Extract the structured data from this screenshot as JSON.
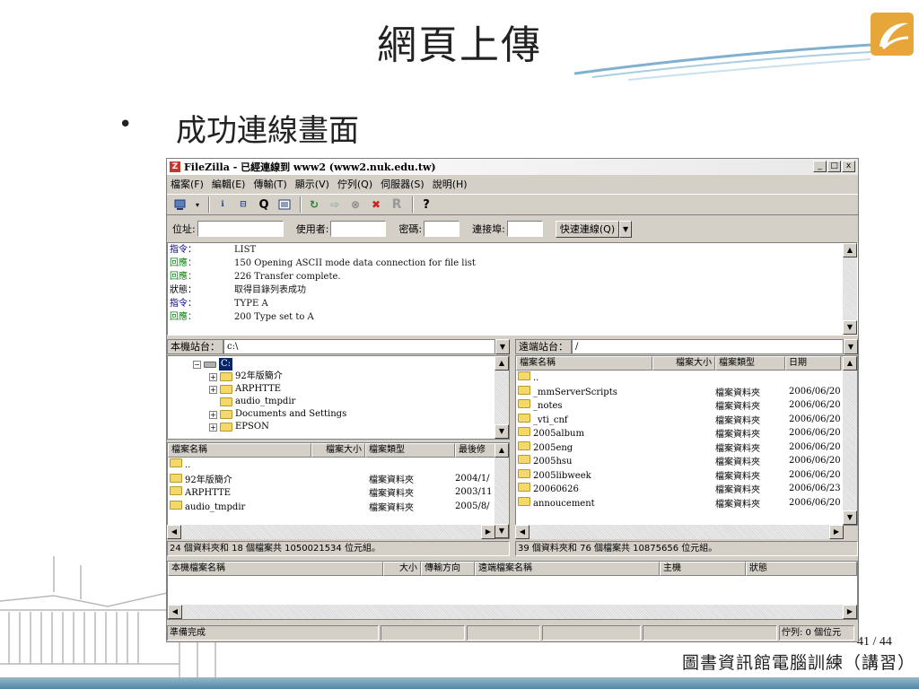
{
  "slide": {
    "title": "網頁上傳",
    "bullet": "•",
    "bullet_text": "成功連線畫面",
    "page_number": "41 / 44",
    "footer": "圖書資訊館電腦訓練（講習）"
  },
  "window": {
    "title": "FileZilla - 已經連線到 www2 (www2.nuk.edu.tw)",
    "app_icon": "Z",
    "controls": {
      "minimize": "_",
      "maximize": "□",
      "close": "x"
    }
  },
  "menu": [
    "檔案(F)",
    "編輯(E)",
    "傳輸(T)",
    "顯示(V)",
    "佇列(Q)",
    "伺服器(S)",
    "說明(H)"
  ],
  "quickconnect": {
    "address_label": "位址:",
    "user_label": "使用者:",
    "password_label": "密碼:",
    "port_label": "連接埠:",
    "button": "快速連線(Q)",
    "dropdown": "▼"
  },
  "log": [
    {
      "kind": "指令：",
      "type": "cmd",
      "text": "LIST"
    },
    {
      "kind": "回應：",
      "type": "resp",
      "text": "150 Opening ASCII mode data connection for file list"
    },
    {
      "kind": "回應：",
      "type": "resp",
      "text": "226 Transfer complete."
    },
    {
      "kind": "狀態：",
      "type": "status",
      "text": "取得目錄列表成功"
    },
    {
      "kind": "指令：",
      "type": "cmd",
      "text": "TYPE A"
    },
    {
      "kind": "回應：",
      "type": "resp",
      "text": "200 Type set to A"
    }
  ],
  "local": {
    "site_label": "本機站台：",
    "path": "c:\\",
    "tree": [
      {
        "label": "C:",
        "indent": 0,
        "expander": "−",
        "drive": true
      },
      {
        "label": "92年版簡介",
        "indent": 1,
        "expander": "+"
      },
      {
        "label": "ARPHTTE",
        "indent": 1,
        "expander": "+"
      },
      {
        "label": "audio_tmpdir",
        "indent": 1,
        "expander": ""
      },
      {
        "label": "Documents and Settings",
        "indent": 1,
        "expander": "+"
      },
      {
        "label": "EPSON",
        "indent": 1,
        "expander": "+"
      }
    ],
    "columns": [
      "檔案名稱",
      "檔案大小",
      "檔案類型",
      "最後修"
    ],
    "files": [
      {
        "name": "..",
        "size": "",
        "type": "",
        "date": ""
      },
      {
        "name": "92年版簡介",
        "size": "",
        "type": "檔案資料夾",
        "date": "2004/1/"
      },
      {
        "name": "ARPHTTE",
        "size": "",
        "type": "檔案資料夾",
        "date": "2003/11"
      },
      {
        "name": "audio_tmpdir",
        "size": "",
        "type": "檔案資料夾",
        "date": "2005/8/"
      }
    ],
    "summary": "24 個資料夾和 18 個檔案共 1050021534 位元組。"
  },
  "remote": {
    "site_label": "遠端站台：",
    "path": "/",
    "columns": [
      "檔案名稱",
      "檔案大小",
      "檔案類型",
      "日期"
    ],
    "files": [
      {
        "name": "..",
        "type": "",
        "date": ""
      },
      {
        "name": "_mmServerScripts",
        "type": "檔案資料夾",
        "date": "2006/06/20"
      },
      {
        "name": "_notes",
        "type": "檔案資料夾",
        "date": "2006/06/20"
      },
      {
        "name": "_vti_cnf",
        "type": "檔案資料夾",
        "date": "2006/06/20"
      },
      {
        "name": "2005album",
        "type": "檔案資料夾",
        "date": "2006/06/20"
      },
      {
        "name": "2005eng",
        "type": "檔案資料夾",
        "date": "2006/06/20"
      },
      {
        "name": "2005hsu",
        "type": "檔案資料夾",
        "date": "2006/06/20"
      },
      {
        "name": "2005libweek",
        "type": "檔案資料夾",
        "date": "2006/06/20"
      },
      {
        "name": "20060626",
        "type": "檔案資料夾",
        "date": "2006/06/23"
      },
      {
        "name": "annoucement",
        "type": "檔案資料夾",
        "date": "2006/06/20"
      }
    ],
    "summary": "39 個資料夾和 76 個檔案共 10875656 位元組。"
  },
  "queue": {
    "columns": [
      "本機檔案名稱",
      "大小",
      "傳輸方向",
      "遠端檔案名稱",
      "主機",
      "狀態"
    ]
  },
  "status": {
    "ready": "準備完成",
    "queue": "佇列: 0 個位元"
  }
}
